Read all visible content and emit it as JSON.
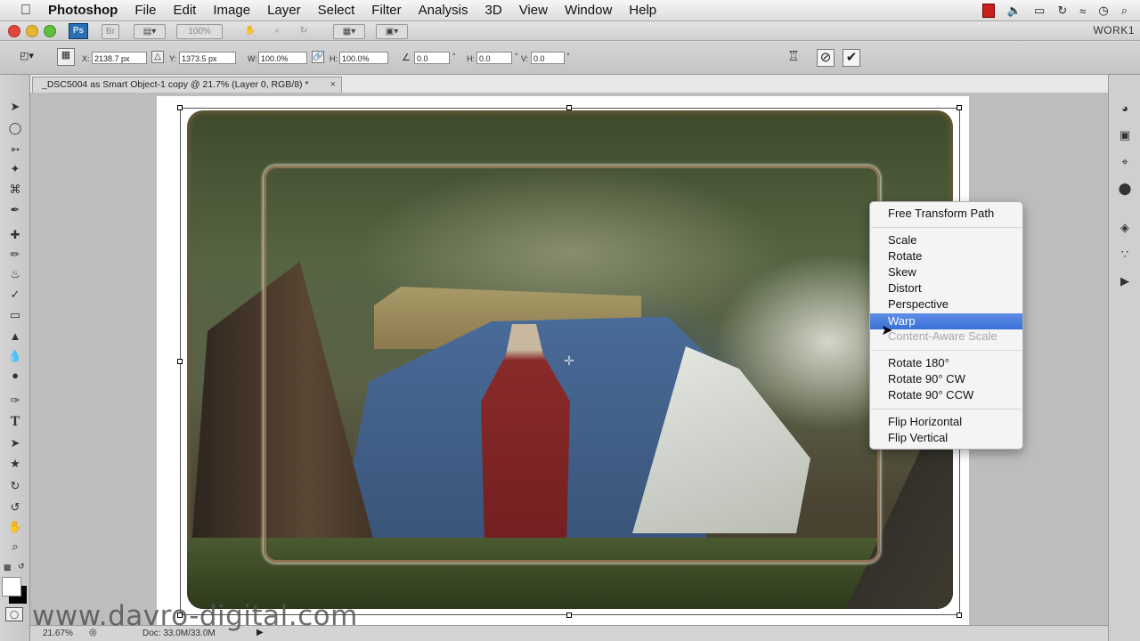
{
  "menubar": {
    "app": "Photoshop",
    "items": [
      "File",
      "Edit",
      "Image",
      "Layer",
      "Select",
      "Filter",
      "Analysis",
      "3D",
      "View",
      "Window",
      "Help"
    ]
  },
  "appbar": {
    "ps_badge": "Ps",
    "zoom_dropdown": "100%",
    "workspace": "WORK1"
  },
  "options": {
    "x_label": "X:",
    "x_value": "2138.7 px",
    "y_label": "Y:",
    "y_value": "1373.5 px",
    "w_label": "W:",
    "w_value": "100.0%",
    "h_label": "H:",
    "h_value": "100.0%",
    "angle_value": "0.0",
    "hskew_label": "H:",
    "hskew_value": "0.0",
    "vskew_label": "V:",
    "vskew_value": "0.0",
    "degree": "°"
  },
  "document": {
    "tab_title": "_DSC5004 as Smart Object-1 copy @ 21.7% (Layer 0, RGB/8) *",
    "close": "×"
  },
  "status": {
    "zoom": "21.67%",
    "doc_size": "Doc: 33.0M/33.0M"
  },
  "watermark": "www.davro-digital.com",
  "context_menu": {
    "items": [
      {
        "label": "Free Transform Path",
        "state": "normal"
      },
      {
        "label": "Scale",
        "state": "normal"
      },
      {
        "label": "Rotate",
        "state": "normal"
      },
      {
        "label": "Skew",
        "state": "normal"
      },
      {
        "label": "Distort",
        "state": "normal"
      },
      {
        "label": "Perspective",
        "state": "normal"
      },
      {
        "label": "Warp",
        "state": "highlighted"
      },
      {
        "label": "Content-Aware Scale",
        "state": "disabled"
      },
      {
        "label": "Rotate 180°",
        "state": "normal"
      },
      {
        "label": "Rotate 90° CW",
        "state": "normal"
      },
      {
        "label": "Rotate 90° CCW",
        "state": "normal"
      },
      {
        "label": "Flip Horizontal",
        "state": "normal"
      },
      {
        "label": "Flip Vertical",
        "state": "normal"
      }
    ]
  },
  "colors": {
    "highlight": "#3a6fd8",
    "traffic_close": "#e2453c",
    "traffic_min": "#e5b534",
    "traffic_max": "#5fbf3e"
  }
}
